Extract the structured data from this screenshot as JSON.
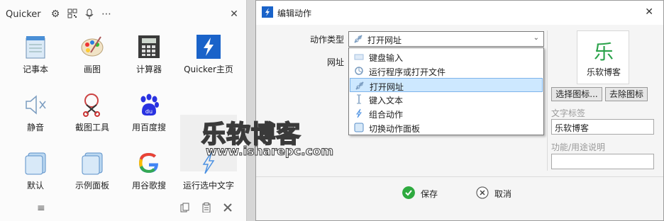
{
  "quicker": {
    "title": "Quicker",
    "items": [
      {
        "label": "记事本",
        "icon": "notepad-icon"
      },
      {
        "label": "画图",
        "icon": "paint-palette-icon"
      },
      {
        "label": "计算器",
        "icon": "calculator-icon"
      },
      {
        "label": "Quicker主页",
        "icon": "quicker-lightning-icon"
      },
      {
        "label": "静音",
        "icon": "speaker-mute-icon"
      },
      {
        "label": "截图工具",
        "icon": "scissors-icon"
      },
      {
        "label": "用百度搜",
        "icon": "baidu-paw-icon"
      },
      {
        "label": "默认",
        "icon": "panel-icon"
      },
      {
        "label": "示例面板",
        "icon": "panel-icon"
      },
      {
        "label": "用谷歌搜",
        "icon": "google-icon"
      },
      {
        "label": "运行选中文字",
        "icon": "lightning-icon"
      }
    ]
  },
  "dialog": {
    "title": "编辑动作",
    "action_type_label": "动作类型",
    "url_label": "网址",
    "selected_type": "打开网址",
    "dropdown_options": [
      {
        "label": "键盘输入",
        "icon": "keyboard-icon"
      },
      {
        "label": "运行程序或打开文件",
        "icon": "run-program-icon"
      },
      {
        "label": "打开网址",
        "icon": "link-icon"
      },
      {
        "label": "键入文本",
        "icon": "text-cursor-icon"
      },
      {
        "label": "组合动作",
        "icon": "lightning-icon"
      },
      {
        "label": "切换动作面板",
        "icon": "panel-switch-icon"
      }
    ],
    "logo_glyph": "乐",
    "logo_caption": "乐软博客",
    "select_icon_button": "选择图标...",
    "remove_icon_button": "去除图标",
    "text_label_caption": "文字标签",
    "text_label_value": "乐软博客",
    "description_caption": "功能/用途说明",
    "description_value": "",
    "save_button": "保存",
    "cancel_button": "取消"
  },
  "watermark": {
    "title": "乐软博客",
    "url": "www.isharepc.com"
  },
  "colors": {
    "selection": "#cde8ff",
    "save_green": "#2eaa3f",
    "quicker_blue": "#1a63c9"
  }
}
